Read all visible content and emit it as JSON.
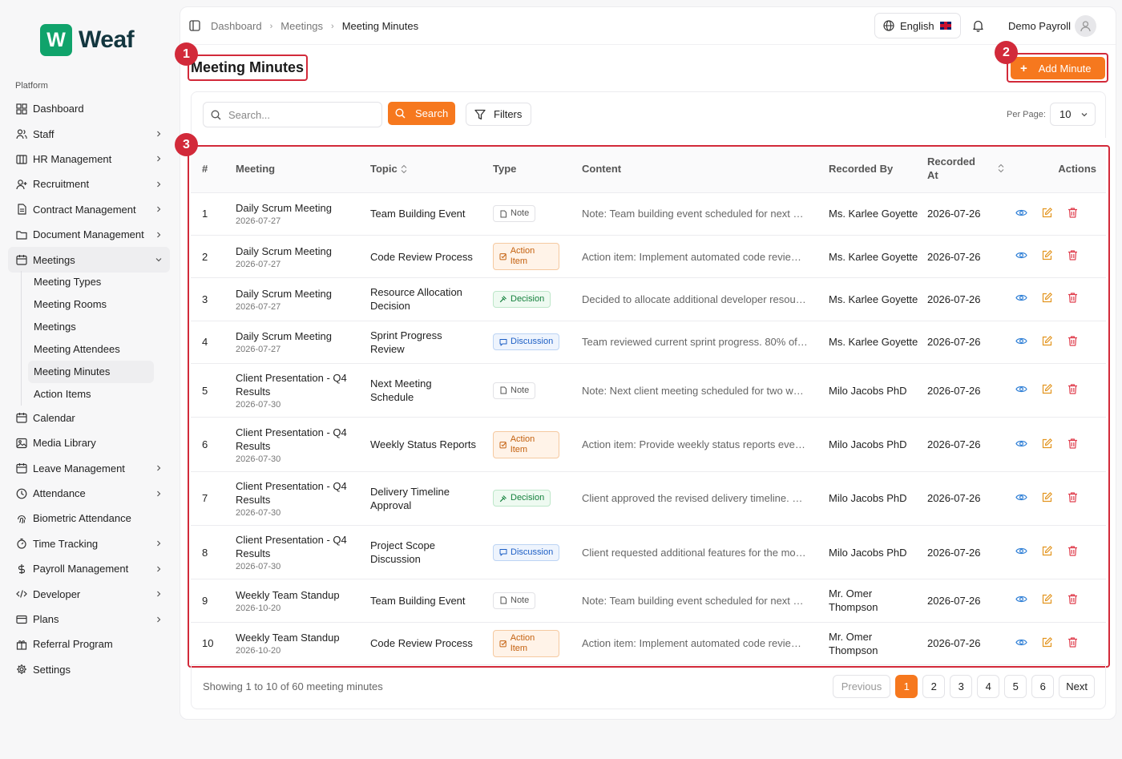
{
  "brand": {
    "name": "Weaf",
    "mark": "W"
  },
  "sidebar": {
    "section_label": "Platform",
    "items": [
      {
        "label": "Dashboard",
        "icon": "dashboard-icon",
        "chevron": false
      },
      {
        "label": "Staff",
        "icon": "users-icon",
        "chevron": true
      },
      {
        "label": "HR Management",
        "icon": "building-icon",
        "chevron": true
      },
      {
        "label": "Recruitment",
        "icon": "user-plus-icon",
        "chevron": true
      },
      {
        "label": "Contract Management",
        "icon": "file-icon",
        "chevron": true
      },
      {
        "label": "Document Management",
        "icon": "folder-icon",
        "chevron": true
      },
      {
        "label": "Meetings",
        "icon": "calendar-icon",
        "chevron": true,
        "expanded": true
      }
    ],
    "meetings_sub": [
      "Meeting Types",
      "Meeting Rooms",
      "Meetings",
      "Meeting Attendees",
      "Meeting Minutes",
      "Action Items"
    ],
    "items_after": [
      {
        "label": "Calendar",
        "icon": "calendar-icon",
        "chevron": false
      },
      {
        "label": "Media Library",
        "icon": "image-icon",
        "chevron": false
      },
      {
        "label": "Leave Management",
        "icon": "calendar-icon",
        "chevron": true
      },
      {
        "label": "Attendance",
        "icon": "clock-icon",
        "chevron": true
      },
      {
        "label": "Biometric Attendance",
        "icon": "fingerprint-icon",
        "chevron": false
      },
      {
        "label": "Time Tracking",
        "icon": "timer-icon",
        "chevron": true
      },
      {
        "label": "Payroll Management",
        "icon": "dollar-icon",
        "chevron": true
      },
      {
        "label": "Developer",
        "icon": "code-icon",
        "chevron": true
      },
      {
        "label": "Plans",
        "icon": "card-icon",
        "chevron": true
      },
      {
        "label": "Referral Program",
        "icon": "gift-icon",
        "chevron": false
      },
      {
        "label": "Settings",
        "icon": "gear-icon",
        "chevron": false
      }
    ]
  },
  "header": {
    "breadcrumb": [
      "Dashboard",
      "Meetings",
      "Meeting Minutes"
    ],
    "language": "English",
    "user": "Demo Payroll"
  },
  "page": {
    "title": "Meeting Minutes",
    "add_button": "Add Minute",
    "search_placeholder": "Search...",
    "search_button": "Search",
    "filters_button": "Filters",
    "per_page_label": "Per Page:",
    "per_page_value": "10"
  },
  "annotations": [
    "1",
    "2",
    "3"
  ],
  "table": {
    "headers": {
      "num": "#",
      "meeting": "Meeting",
      "topic": "Topic",
      "type": "Type",
      "content": "Content",
      "recorded_by": "Recorded By",
      "recorded_at": "Recorded At",
      "actions": "Actions"
    },
    "rows": [
      {
        "num": "1",
        "meeting": "Daily Scrum Meeting",
        "date": "2026-07-27",
        "topic": "Team Building Event",
        "type": "Note",
        "kind": "note",
        "content": "Note: Team building event scheduled for next m...",
        "recorded_by": "Ms. Karlee Goyette",
        "recorded_at": "2026-07-26"
      },
      {
        "num": "2",
        "meeting": "Daily Scrum Meeting",
        "date": "2026-07-27",
        "topic": "Code Review Process",
        "type": "Action Item",
        "kind": "action",
        "content": "Action item: Implement automated code review ...",
        "recorded_by": "Ms. Karlee Goyette",
        "recorded_at": "2026-07-26"
      },
      {
        "num": "3",
        "meeting": "Daily Scrum Meeting",
        "date": "2026-07-27",
        "topic": "Resource Allocation Decision",
        "type": "Decision",
        "kind": "decision",
        "content": "Decided to allocate additional developer resourc...",
        "recorded_by": "Ms. Karlee Goyette",
        "recorded_at": "2026-07-26"
      },
      {
        "num": "4",
        "meeting": "Daily Scrum Meeting",
        "date": "2026-07-27",
        "topic": "Sprint Progress Review",
        "type": "Discussion",
        "kind": "discussion",
        "content": "Team reviewed current sprint progress. 80% of p...",
        "recorded_by": "Ms. Karlee Goyette",
        "recorded_at": "2026-07-26"
      },
      {
        "num": "5",
        "meeting": "Client Presentation - Q4 Results",
        "date": "2026-07-30",
        "topic": "Next Meeting Schedule",
        "type": "Note",
        "kind": "note",
        "content": "Note: Next client meeting scheduled for two wee...",
        "recorded_by": "Milo Jacobs PhD",
        "recorded_at": "2026-07-26"
      },
      {
        "num": "6",
        "meeting": "Client Presentation - Q4 Results",
        "date": "2026-07-30",
        "topic": "Weekly Status Reports",
        "type": "Action Item",
        "kind": "action",
        "content": "Action item: Provide weekly status reports every ...",
        "recorded_by": "Milo Jacobs PhD",
        "recorded_at": "2026-07-26"
      },
      {
        "num": "7",
        "meeting": "Client Presentation - Q4 Results",
        "date": "2026-07-30",
        "topic": "Delivery Timeline Approval",
        "type": "Decision",
        "kind": "decision",
        "content": "Client approved the revised delivery timeline. Ne...",
        "recorded_by": "Milo Jacobs PhD",
        "recorded_at": "2026-07-26"
      },
      {
        "num": "8",
        "meeting": "Client Presentation - Q4 Results",
        "date": "2026-07-30",
        "topic": "Project Scope Discussion",
        "type": "Discussion",
        "kind": "discussion",
        "content": "Client requested additional features for the mobi...",
        "recorded_by": "Milo Jacobs PhD",
        "recorded_at": "2026-07-26"
      },
      {
        "num": "9",
        "meeting": "Weekly Team Standup",
        "date": "2026-10-20",
        "topic": "Team Building Event",
        "type": "Note",
        "kind": "note",
        "content": "Note: Team building event scheduled for next m...",
        "recorded_by": "Mr. Omer Thompson",
        "recorded_at": "2026-07-26"
      },
      {
        "num": "10",
        "meeting": "Weekly Team Standup",
        "date": "2026-10-20",
        "topic": "Code Review Process",
        "type": "Action Item",
        "kind": "action",
        "content": "Action item: Implement automated code review ...",
        "recorded_by": "Mr. Omer Thompson",
        "recorded_at": "2026-07-26"
      }
    ]
  },
  "footer": {
    "showing": "Showing 1 to 10 of 60 meeting minutes",
    "previous": "Previous",
    "pages": [
      "1",
      "2",
      "3",
      "4",
      "5",
      "6"
    ],
    "current_page": "1",
    "next": "Next"
  },
  "colors": {
    "accent": "#f6781e",
    "brand": "#10a36b",
    "annotation": "#d22a3a"
  }
}
